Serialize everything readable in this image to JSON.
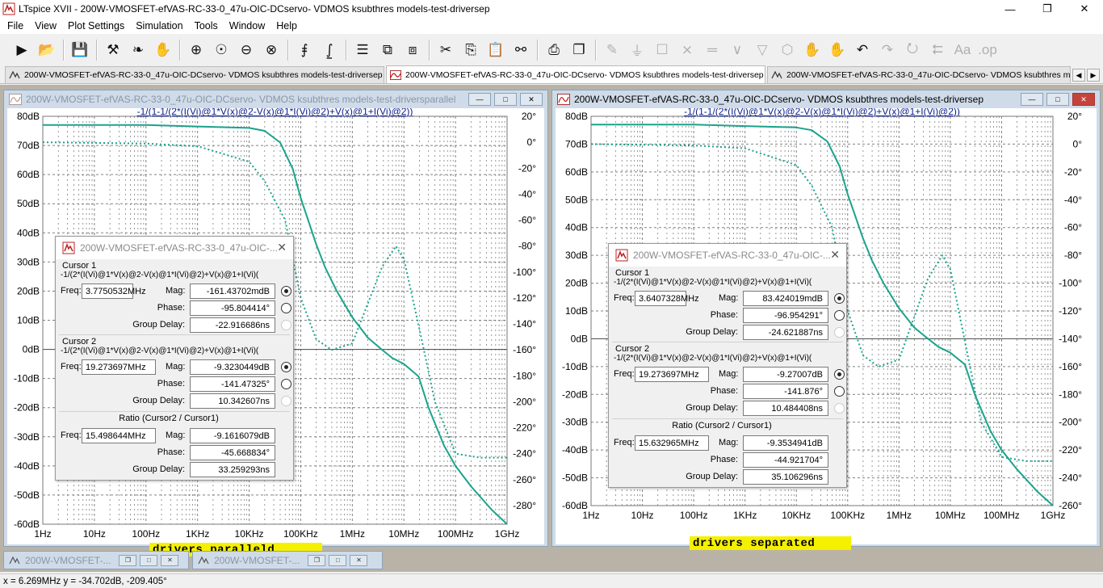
{
  "window": {
    "title": "LTspice XVII - 200W-VMOSFET-efVAS-RC-33-0_47u-OIC-DCservo- VDMOS ksubthres models-test-driversep",
    "minimize": "—",
    "maximize": "❐",
    "close": "✕"
  },
  "menu": [
    "File",
    "View",
    "Plot Settings",
    "Simulation",
    "Tools",
    "Window",
    "Help"
  ],
  "toolbar": [
    {
      "icon": "run-icon",
      "glyph": "▶"
    },
    {
      "icon": "open-folder-icon",
      "glyph": "📂"
    },
    {
      "sep": true
    },
    {
      "icon": "save-icon",
      "glyph": "💾"
    },
    {
      "sep": true
    },
    {
      "icon": "control-panel-icon",
      "glyph": "⚒"
    },
    {
      "icon": "halt-icon",
      "glyph": "❧"
    },
    {
      "icon": "pan-hand-icon",
      "glyph": "✋"
    },
    {
      "sep": true
    },
    {
      "icon": "zoom-in-icon",
      "glyph": "⊕"
    },
    {
      "icon": "zoom-fit-icon",
      "glyph": "☉"
    },
    {
      "icon": "zoom-out-icon",
      "glyph": "⊖"
    },
    {
      "icon": "zoom-cancel-icon",
      "glyph": "⊗"
    },
    {
      "sep": true
    },
    {
      "icon": "autorange-icon",
      "glyph": "⨎"
    },
    {
      "icon": "fft-icon",
      "glyph": "⨜"
    },
    {
      "sep": true
    },
    {
      "icon": "tile-horizontal-icon",
      "glyph": "☰"
    },
    {
      "icon": "cascade-icon",
      "glyph": "⧉"
    },
    {
      "icon": "tile-vertical-icon",
      "glyph": "⧈"
    },
    {
      "sep": true
    },
    {
      "icon": "cut-icon",
      "glyph": "✂"
    },
    {
      "icon": "copy-icon",
      "glyph": "⎘"
    },
    {
      "icon": "paste-icon",
      "glyph": "📋"
    },
    {
      "icon": "find-icon",
      "glyph": "⚯"
    },
    {
      "sep": true
    },
    {
      "icon": "print-icon",
      "glyph": "⎙"
    },
    {
      "icon": "print-setup-icon",
      "glyph": "❐"
    },
    {
      "sep": true
    },
    {
      "icon": "draw-wire-icon",
      "glyph": "✎",
      "disabled": true
    },
    {
      "icon": "ground-icon",
      "glyph": "⏚",
      "disabled": true
    },
    {
      "icon": "label-net-icon",
      "glyph": "☐",
      "disabled": true
    },
    {
      "icon": "resistor-icon",
      "glyph": "⨯",
      "disabled": true
    },
    {
      "icon": "capacitor-icon",
      "glyph": "═",
      "disabled": true
    },
    {
      "icon": "inductor-icon",
      "glyph": "∨",
      "disabled": true
    },
    {
      "icon": "diode-icon",
      "glyph": "▽",
      "disabled": true
    },
    {
      "icon": "component-icon",
      "glyph": "⬡",
      "disabled": true
    },
    {
      "icon": "move-icon",
      "glyph": "✋",
      "disabled": true
    },
    {
      "icon": "drag-icon",
      "glyph": "✋",
      "disabled": true
    },
    {
      "icon": "undo-icon",
      "glyph": "↶"
    },
    {
      "icon": "redo-icon",
      "glyph": "↷",
      "disabled": true
    },
    {
      "icon": "rotate-icon",
      "glyph": "⭮",
      "disabled": true
    },
    {
      "icon": "mirror-icon",
      "glyph": "⮄",
      "disabled": true
    },
    {
      "icon": "text-icon",
      "glyph": "Aa",
      "disabled": true
    },
    {
      "icon": "spice-directive-icon",
      "glyph": ".op",
      "disabled": true
    }
  ],
  "tabs": [
    {
      "label": "200W-VMOSFET-efVAS-RC-33-0_47u-OIC-DCservo- VDMOS ksubthres models-test-driversep",
      "kind": "schematic",
      "active": false
    },
    {
      "label": "200W-VMOSFET-efVAS-RC-33-0_47u-OIC-DCservo- VDMOS ksubthres models-test-driversep",
      "kind": "waveform",
      "active": true
    },
    {
      "label": "200W-VMOSFET-efVAS-RC-33-0_47u-OIC-DCservo- VDMOS ksubthres models-test-drive",
      "kind": "schematic",
      "active": false
    }
  ],
  "tab_nav": {
    "prev": "◀",
    "next": "▶"
  },
  "plot_left": {
    "title": "200W-VMOSFET-efVAS-RC-33-0_47u-OIC-DCservo- VDMOS ksubthres models-test-driversparallel",
    "expr": "-1/(1-1/(2*(I(Vi)@1*V(x)@2-V(x)@1*I(Vi)@2)+V(x)@1+I(Vi)@2))",
    "banner": "drivers paralleld",
    "btn_min": "—",
    "btn_max": "□",
    "btn_close": "✕"
  },
  "plot_right": {
    "title": "200W-VMOSFET-efVAS-RC-33-0_47u-OIC-DCservo- VDMOS ksubthres models-test-driversep",
    "expr": "-1/(1-1/(2*(I(Vi)@1*V(x)@2-V(x)@1*I(Vi)@2)+V(x)@1+I(Vi)@2))",
    "banner": "drivers separated",
    "btn_min": "—",
    "btn_max": "□",
    "btn_close": "✕"
  },
  "cursor_left": {
    "title": "200W-VMOSFET-efVAS-RC-33-0_47u-OIC-...",
    "close": "✕",
    "c1_label": "Cursor 1",
    "c1_expr": "-1/(2*(I(Vi)@1*V(x)@2-V(x)@1*I(Vi)@2)+V(x)@1+I(Vi)(",
    "c1_freq": "3.7750532MHz",
    "c1_mag": "-161.43702mdB",
    "c1_phase": "-95.804414°",
    "c1_gd": "-22.916686ns",
    "c2_label": "Cursor 2",
    "c2_expr": "-1/(2*(I(Vi)@1*V(x)@2-V(x)@1*I(Vi)@2)+V(x)@1+I(Vi)(",
    "c2_freq": "19.273697MHz",
    "c2_mag": "-9.3230449dB",
    "c2_phase": "-141.47325°",
    "c2_gd": "10.342607ns",
    "ratio_label": "Ratio (Cursor2 / Cursor1)",
    "r_freq": "15.498644MHz",
    "r_mag": "-9.1616079dB",
    "r_phase": "-45.668834°",
    "r_gd": "33.259293ns"
  },
  "cursor_right": {
    "title": "200W-VMOSFET-efVAS-RC-33-0_47u-OIC-...",
    "close": "✕",
    "c1_label": "Cursor 1",
    "c1_expr": "-1/(2*(I(Vi)@1*V(x)@2-V(x)@1*I(Vi)@2)+V(x)@1+I(Vi)(",
    "c1_freq": "3.6407328MHz",
    "c1_mag": "83.424019mdB",
    "c1_phase": "-96.954291°",
    "c1_gd": "-24.621887ns",
    "c2_label": "Cursor 2",
    "c2_expr": "-1/(2*(I(Vi)@1*V(x)@2-V(x)@1*I(Vi)@2)+V(x)@1+I(Vi)(",
    "c2_freq": "19.273697MHz",
    "c2_mag": "-9.27007dB",
    "c2_phase": "-141.876°",
    "c2_gd": "10.484408ns",
    "ratio_label": "Ratio (Cursor2 / Cursor1)",
    "r_freq": "15.632965MHz",
    "r_mag": "-9.3534941dB",
    "r_phase": "-44.921704°",
    "r_gd": "35.106296ns"
  },
  "labels": {
    "freq": "Freq:",
    "mag": "Mag:",
    "phase": "Phase:",
    "gd": "Group Delay:"
  },
  "minimized": [
    {
      "title": "200W-VMOSFET-..."
    },
    {
      "title": "200W-VMOSFET-..."
    }
  ],
  "status": "x = 6.269MHz   y = -34.702dB, -209.405°",
  "colors": {
    "trace": "#1aa38c",
    "grid": "#808080",
    "axis_text": "#000000",
    "expr_text": "#0a1c8c",
    "banner": "#f5f000"
  },
  "chart_data": [
    {
      "type": "line",
      "title": "-1/(1-1/(2*(I(Vi)@1*V(x)@2-V(x)@1*I(Vi)@2)+V(x)@1+I(Vi)@2))",
      "x_scale": "log",
      "xlim": [
        "1Hz",
        "1GHz"
      ],
      "x_ticks": [
        "1Hz",
        "10Hz",
        "100Hz",
        "1KHz",
        "10KHz",
        "100KHz",
        "1MHz",
        "10MHz",
        "100MHz",
        "1GHz"
      ],
      "y_left_ticks": [
        "80dB",
        "70dB",
        "60dB",
        "50dB",
        "40dB",
        "30dB",
        "20dB",
        "10dB",
        "0dB",
        "-10dB",
        "-20dB",
        "-30dB",
        "-40dB",
        "-50dB",
        "-60dB"
      ],
      "y_right_ticks": [
        "20°",
        "0°",
        "-20°",
        "-40°",
        "-60°",
        "-80°",
        "-100°",
        "-120°",
        "-140°",
        "-160°",
        "-180°",
        "-200°",
        "-220°",
        "-240°",
        "-260°",
        "-280°"
      ],
      "ylim_mag_db": [
        -60,
        80
      ],
      "ylim_phase_deg": [
        -280,
        20
      ],
      "grid": true,
      "series": [
        {
          "style": "solid",
          "unit": "dB",
          "points": [
            [
              1,
              77
            ],
            [
              10,
              77
            ],
            [
              100,
              77
            ],
            [
              1000,
              76.5
            ],
            [
              10000,
              76
            ],
            [
              20000,
              75
            ],
            [
              40000,
              71
            ],
            [
              70000,
              62
            ],
            [
              100000,
              52
            ],
            [
              200000,
              36
            ],
            [
              300000,
              28
            ],
            [
              500000,
              20
            ],
            [
              1000000,
              11
            ],
            [
              2000000,
              4
            ],
            [
              3775053,
              -0.16
            ],
            [
              6000000,
              -3
            ],
            [
              10000000,
              -5
            ],
            [
              19273697,
              -9.3
            ],
            [
              30000000,
              -20
            ],
            [
              60000000,
              -33
            ],
            [
              100000000,
              -40
            ],
            [
              200000000,
              -47
            ],
            [
              500000000,
              -55
            ],
            [
              1000000000,
              -60
            ]
          ]
        },
        {
          "style": "dotted",
          "unit": "deg",
          "points": [
            [
              1,
              0
            ],
            [
              100,
              -1
            ],
            [
              1000,
              -3
            ],
            [
              10000,
              -15
            ],
            [
              20000,
              -30
            ],
            [
              50000,
              -60
            ],
            [
              100000,
              -120
            ],
            [
              200000,
              -152
            ],
            [
              400000,
              -160
            ],
            [
              1000000,
              -155
            ],
            [
              3775053,
              -96
            ],
            [
              7000000,
              -80
            ],
            [
              10000000,
              -90
            ],
            [
              19273697,
              -141
            ],
            [
              40000000,
              -200
            ],
            [
              100000000,
              -240
            ],
            [
              300000000,
              -243
            ],
            [
              1000000000,
              -243
            ]
          ]
        }
      ]
    },
    {
      "type": "line",
      "title": "-1/(1-1/(2*(I(Vi)@1*V(x)@2-V(x)@1*I(Vi)@2)+V(x)@1+I(Vi)@2))",
      "x_scale": "log",
      "xlim": [
        "1Hz",
        "1GHz"
      ],
      "x_ticks": [
        "1Hz",
        "10Hz",
        "100Hz",
        "1KHz",
        "10KHz",
        "100KHz",
        "1MHz",
        "10MHz",
        "100MHz",
        "1GHz"
      ],
      "y_left_ticks": [
        "80dB",
        "70dB",
        "60dB",
        "50dB",
        "40dB",
        "30dB",
        "20dB",
        "10dB",
        "0dB",
        "-10dB",
        "-20dB",
        "-30dB",
        "-40dB",
        "-50dB",
        "-60dB"
      ],
      "y_right_ticks": [
        "20°",
        "0°",
        "-20°",
        "-40°",
        "-60°",
        "-80°",
        "-100°",
        "-120°",
        "-140°",
        "-160°",
        "-180°",
        "-200°",
        "-220°",
        "-240°",
        "-260°"
      ],
      "ylim_mag_db": [
        -60,
        80
      ],
      "ylim_phase_deg": [
        -260,
        20
      ],
      "grid": true,
      "series": [
        {
          "style": "solid",
          "unit": "dB",
          "points": [
            [
              1,
              77
            ],
            [
              10,
              77
            ],
            [
              100,
              77
            ],
            [
              1000,
              76.5
            ],
            [
              10000,
              76
            ],
            [
              20000,
              75
            ],
            [
              40000,
              71
            ],
            [
              70000,
              62
            ],
            [
              100000,
              52
            ],
            [
              200000,
              36
            ],
            [
              300000,
              28
            ],
            [
              500000,
              20
            ],
            [
              1000000,
              11
            ],
            [
              2000000,
              4
            ],
            [
              3640733,
              0.08
            ],
            [
              6000000,
              -3
            ],
            [
              10000000,
              -5
            ],
            [
              19273697,
              -9.27
            ],
            [
              30000000,
              -20
            ],
            [
              60000000,
              -33
            ],
            [
              100000000,
              -40
            ],
            [
              200000000,
              -47
            ],
            [
              500000000,
              -55
            ],
            [
              1000000000,
              -60
            ]
          ]
        },
        {
          "style": "dotted",
          "unit": "deg",
          "points": [
            [
              1,
              0
            ],
            [
              100,
              -1
            ],
            [
              1000,
              -3
            ],
            [
              10000,
              -15
            ],
            [
              20000,
              -30
            ],
            [
              50000,
              -60
            ],
            [
              100000,
              -120
            ],
            [
              200000,
              -152
            ],
            [
              400000,
              -160
            ],
            [
              1000000,
              -155
            ],
            [
              3640733,
              -97
            ],
            [
              7000000,
              -80
            ],
            [
              10000000,
              -90
            ],
            [
              19273697,
              -142
            ],
            [
              40000000,
              -200
            ],
            [
              100000000,
              -225
            ],
            [
              300000000,
              -228
            ],
            [
              1000000000,
              -228
            ]
          ]
        }
      ]
    }
  ]
}
